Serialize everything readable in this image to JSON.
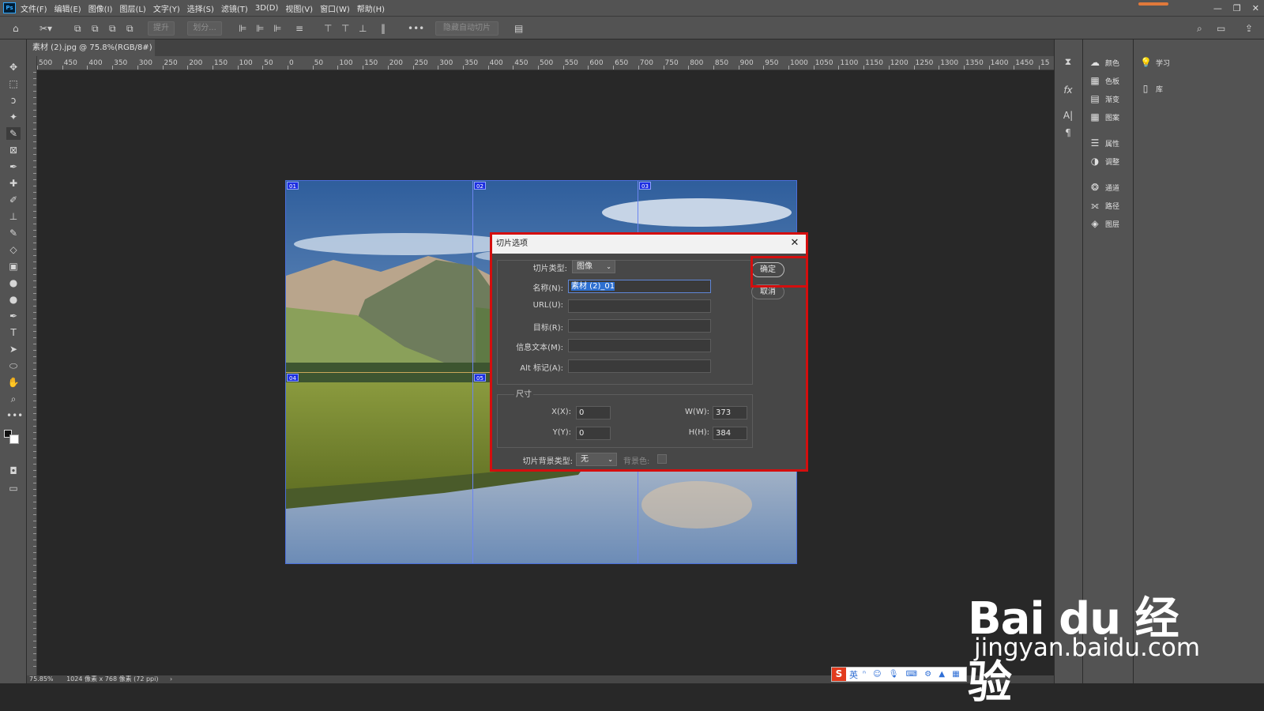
{
  "app": {
    "logo": "Ps"
  },
  "menu": [
    "文件(F)",
    "编辑(E)",
    "图像(I)",
    "图层(L)",
    "文字(Y)",
    "选择(S)",
    "滤镜(T)",
    "3D(D)",
    "视图(V)",
    "窗口(W)",
    "帮助(H)"
  ],
  "optionsbar": {
    "promote_label": "提升",
    "divide_label": "划分...",
    "hide_auto_slices_label": "隐藏自动切片",
    "more": "•••"
  },
  "document": {
    "tab_title": "素材 (2).jpg @ 75.8%(RGB/8#) *",
    "close": "×"
  },
  "ruler": {
    "h_ticks": [
      "500",
      "450",
      "400",
      "350",
      "300",
      "250",
      "200",
      "150",
      "100",
      "50",
      "0",
      "50",
      "100",
      "150",
      "200",
      "250",
      "300",
      "350",
      "400",
      "450",
      "500",
      "550",
      "600",
      "650",
      "700",
      "750",
      "800",
      "850",
      "900",
      "950",
      "1000",
      "1050",
      "1100",
      "1150",
      "1200",
      "1250",
      "1300",
      "1350",
      "1400",
      "1450",
      "15"
    ]
  },
  "slices": {
    "badges": [
      "01",
      "02",
      "03",
      "04",
      "05"
    ]
  },
  "status": {
    "zoom": "75.85%",
    "doc_info": "1024 像素 x 768 像素 (72 ppi)",
    "arrow": "›"
  },
  "panels": {
    "group1": [
      {
        "icon": "color-icon",
        "label": "颜色"
      },
      {
        "icon": "swatches-icon",
        "label": "色板"
      },
      {
        "icon": "gradient-icon",
        "label": "渐变"
      },
      {
        "icon": "pattern-icon",
        "label": "图案"
      }
    ],
    "group2": [
      {
        "icon": "properties-icon",
        "label": "属性"
      },
      {
        "icon": "adjustments-icon",
        "label": "调整"
      }
    ],
    "group3": [
      {
        "icon": "channels-icon",
        "label": "通道"
      },
      {
        "icon": "paths-icon",
        "label": "路径"
      },
      {
        "icon": "layers-icon",
        "label": "图层"
      }
    ],
    "learn": {
      "label": "学习"
    },
    "library": {
      "label": "库"
    }
  },
  "dialog": {
    "title": "切片选项",
    "close": "✕",
    "slice_type_label": "切片类型:",
    "slice_type_value": "图像",
    "name_label": "名称(N):",
    "name_value": "素材 (2)_01",
    "url_label": "URL(U):",
    "url_value": "",
    "target_label": "目标(R):",
    "target_value": "",
    "message_label": "信息文本(M):",
    "message_value": "",
    "alt_label": "Alt 标记(A):",
    "alt_value": "",
    "dimensions_label": "尺寸",
    "x_label": "X(X):",
    "x_value": "0",
    "y_label": "Y(Y):",
    "y_value": "0",
    "w_label": "W(W):",
    "w_value": "373",
    "h_label": "H(H):",
    "h_value": "384",
    "bg_type_label": "切片背景类型:",
    "bg_type_value": "无",
    "bg_color_label": "背景色:",
    "ok_label": "确定",
    "cancel_label": "取消"
  },
  "ime": {
    "logo": "S",
    "lang": "英",
    "icons": "ⁿ ☺ 🎙 ⌨ ⚙ ▲ ▦"
  },
  "watermark": {
    "logo": "Bai du 经验",
    "url": "jingyan.baidu.com"
  },
  "colors": {
    "highlight": "#d40e0e",
    "slice_badge": "#1c2ee0",
    "ui_bg": "#535353"
  }
}
